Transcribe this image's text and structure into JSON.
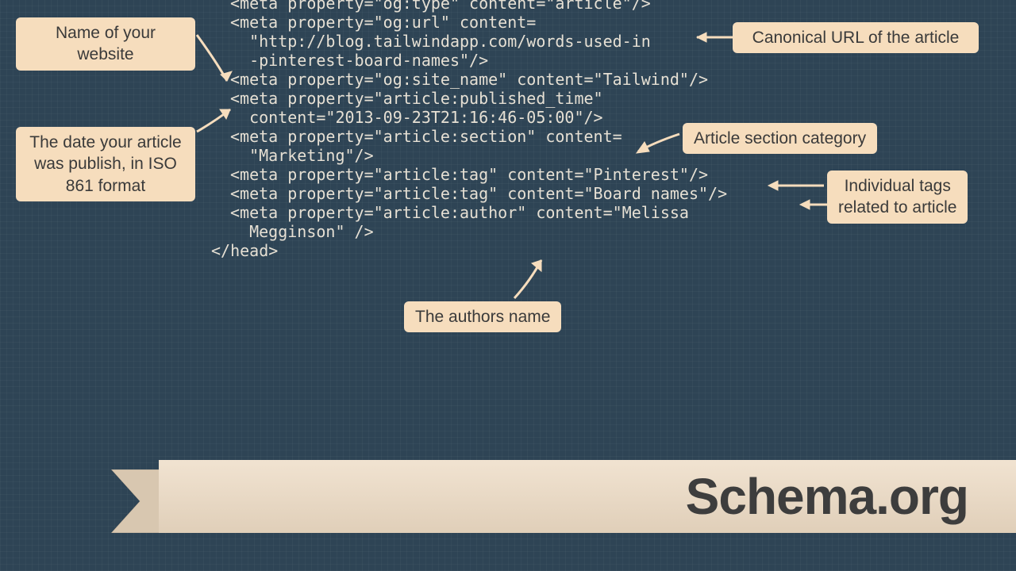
{
  "labels": {
    "websiteName": "Name of your website",
    "canonicalUrl": "Canonical URL of the article",
    "publishedDate": "The date your article\nwas publish, in ISO\n861 format",
    "sectionCategory": "Article section category",
    "tags": "Individual tags\nrelated to article",
    "author": "The authors name"
  },
  "code": {
    "l1": "<meta property=\"og:type\" content=\"article\"/>",
    "l2": "<meta property=\"og:url\" content=",
    "l3": "  \"http://blog.tailwindapp.com/words-used-in",
    "l4": "  -pinterest-board-names\"/>",
    "l5": "<meta property=\"og:site_name\" content=\"Tailwind\"/>",
    "l6": "<meta property=\"article:published_time\"",
    "l7": "  content=\"2013-09-23T21:16:46-05:00\"/>",
    "l8": "<meta property=\"article:section\" content=",
    "l9": "  \"Marketing\"/>",
    "l10": "<meta property=\"article:tag\" content=\"Pinterest\"/>",
    "l11": "<meta property=\"article:tag\" content=\"Board names\"/>",
    "l12": "<meta property=\"article:author\" content=\"Melissa",
    "l13": "  Megginson\" />",
    "l14": "</head>"
  },
  "ribbon": {
    "title": "Schema.org"
  }
}
